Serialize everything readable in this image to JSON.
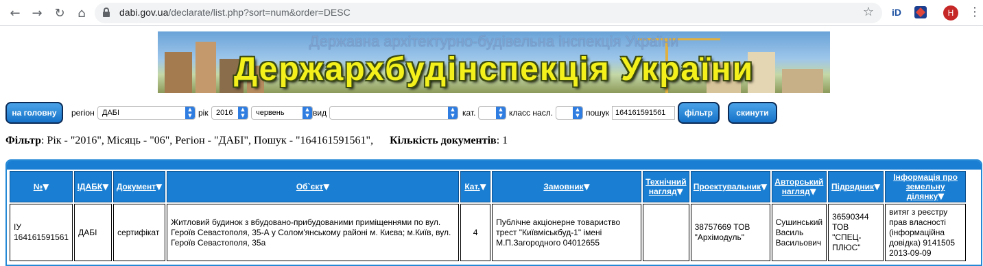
{
  "browser": {
    "url_host": "dabi.gov.ua",
    "url_path": "/declarate/list.php?sort=num&order=DESC",
    "avatar_letter": "H",
    "ext1_label": "iD"
  },
  "banner": {
    "subtitle": "Державна архітектурно-будівельна інспекція України",
    "title": "Держархбудінспекція України"
  },
  "toolbar": {
    "home_button": "на головну",
    "region_label": "регіон",
    "region_value": "ДАБІ",
    "year_label": "рік",
    "year_value": "2016",
    "month_value": "червень",
    "type_label": "вид",
    "type_value": "",
    "cat_label": "кат.",
    "cat_value": "",
    "class_label": "класс насл.",
    "class_value": "",
    "search_label": "пошук",
    "search_value": "164161591561",
    "filter_button": "фільтр",
    "reset_button": "скинути"
  },
  "summary": {
    "filter_label": "Фільтр",
    "filter_text": ": Рік - \"2016\", Місяць - \"06\", Регіон - \"ДАБІ\", Пошук - \"164161591561\",",
    "count_label": "Кількість документів",
    "count_value": ": 1"
  },
  "table": {
    "headers": [
      "№",
      "ІДАБК",
      "Документ",
      "Об`єкт",
      "Кат.",
      "Замовник",
      "Технічний нагляд",
      "Проектувальник",
      "Авторський нагляд",
      "Підрядник",
      "Інформація про земельну ділянку"
    ],
    "row": {
      "num": "ІУ 164161591561",
      "idabk": "ДАБІ",
      "doc": "сертифікат",
      "object": "Житловий будинок з вбудовано-прибудованими приміщеннями по вул. Героїв Севастополя, 35-А у Солом'янському районі м. Києва; м.Київ, вул. Героїв Севастополя, 35а",
      "cat": "4",
      "customer": "Публічне акціонерне товариство трест \"Київміськбуд-1\" імені М.П.Загородного 04012655",
      "tech": "",
      "designer": "38757669 ТОВ \"Архімодуль\"",
      "author": "Сушинський Василь Васильович",
      "contractor": "36590344 ТОВ \"СПЕЦ-ПЛЮС\"",
      "land": "витяг з реєстру прав власності (інформаційна довідка) 9141505 2013-09-09"
    }
  }
}
